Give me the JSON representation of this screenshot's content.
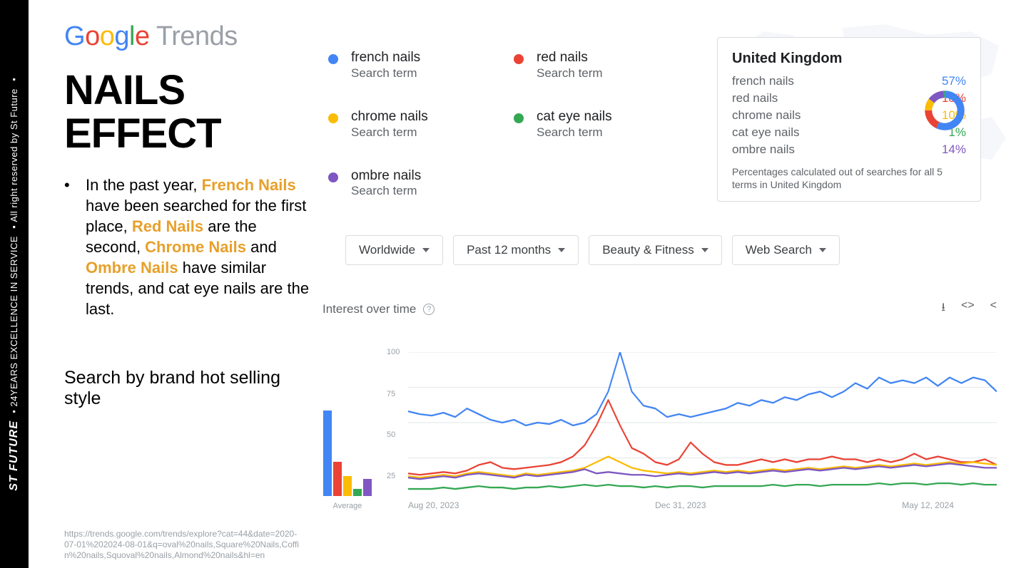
{
  "sidebar": {
    "brand": "ST FUTURE",
    "tag1": "24YEARS EXCELLENCE IN SERVICE",
    "tag2": "All right reserved by St Future"
  },
  "logo": {
    "g1": "G",
    "g2": "o",
    "g3": "o",
    "g4": "g",
    "g5": "l",
    "g6": "e",
    "trends": " Trends"
  },
  "headline": "NAILS EFFECT",
  "bullet": {
    "p1": "In the past year, ",
    "h1": "French Nails",
    "p2": " have been searched for the first place, ",
    "h2": "Red Nails",
    "p3": " are the second, ",
    "h3": "Chrome Nails",
    "p4": " and ",
    "h4": "Ombre Nails",
    "p5": " have similar trends, and cat eye nails are the last."
  },
  "subhead": "Search by brand hot selling style",
  "src_url": "https://trends.google.com/trends/explore?cat=44&date=2020-07-01%202024-08-01&q=oval%20nails,Square%20Nails,Coffin%20nails,Squoval%20nails,Almond%20nails&hl=en",
  "search_terms": [
    {
      "name": "french nails",
      "sub": "Search term",
      "color": "#4285F4"
    },
    {
      "name": "red nails",
      "sub": "Search term",
      "color": "#EA4335"
    },
    {
      "name": "chrome nails",
      "sub": "Search term",
      "color": "#FBBC05"
    },
    {
      "name": "cat eye nails",
      "sub": "Search term",
      "color": "#34A853"
    },
    {
      "name": "ombre nails",
      "sub": "Search term",
      "color": "#7E57C2"
    }
  ],
  "uk": {
    "title": "United Kingdom",
    "rows": [
      {
        "name": "french nails",
        "pct": "57%",
        "cls": "blue"
      },
      {
        "name": "red nails",
        "pct": "18%",
        "cls": "red"
      },
      {
        "name": "chrome nails",
        "pct": "10%",
        "cls": "yellow"
      },
      {
        "name": "cat eye nails",
        "pct": "1%",
        "cls": "green"
      },
      {
        "name": "ombre nails",
        "pct": "14%",
        "cls": "purple"
      }
    ],
    "note": "Percentages calculated out of searches for all 5 terms in United Kingdom"
  },
  "filters": [
    "Worldwide",
    "Past 12 months",
    "Beauty & Fitness",
    "Web Search"
  ],
  "iot": {
    "title": "Interest over time"
  },
  "chart_data": {
    "type": "line",
    "ylim": [
      0,
      100
    ],
    "yticks": [
      25,
      50,
      75,
      100
    ],
    "xticks": [
      "Aug 20, 2023",
      "Dec 31, 2023",
      "May 12, 2024"
    ],
    "average_bars": {
      "label": "Average",
      "values": {
        "french": 62,
        "red": 25,
        "chrome": 14,
        "ombre": 12,
        "cateye": 5
      }
    },
    "series": [
      {
        "name": "french nails",
        "color": "#4285F4",
        "values": [
          58,
          56,
          55,
          57,
          54,
          60,
          56,
          52,
          50,
          52,
          48,
          50,
          49,
          52,
          48,
          50,
          56,
          72,
          100,
          72,
          62,
          60,
          54,
          56,
          54,
          56,
          58,
          60,
          64,
          62,
          66,
          64,
          68,
          66,
          70,
          72,
          68,
          72,
          78,
          74,
          82,
          78,
          80,
          78,
          82,
          76,
          82,
          78,
          82,
          80,
          72
        ]
      },
      {
        "name": "red nails",
        "color": "#EA4335",
        "values": [
          14,
          13,
          14,
          15,
          14,
          16,
          20,
          22,
          18,
          17,
          18,
          19,
          20,
          22,
          26,
          34,
          48,
          66,
          48,
          32,
          28,
          22,
          20,
          24,
          36,
          28,
          22,
          20,
          20,
          22,
          24,
          22,
          24,
          22,
          24,
          24,
          26,
          24,
          24,
          22,
          24,
          22,
          24,
          28,
          24,
          26,
          24,
          22,
          22,
          24,
          20
        ]
      },
      {
        "name": "chrome nails",
        "color": "#FBBC05",
        "values": [
          12,
          11,
          12,
          13,
          12,
          14,
          15,
          14,
          13,
          12,
          14,
          13,
          14,
          15,
          16,
          18,
          22,
          26,
          22,
          18,
          16,
          15,
          14,
          15,
          14,
          15,
          16,
          15,
          16,
          15,
          16,
          17,
          16,
          17,
          18,
          17,
          18,
          19,
          18,
          19,
          20,
          19,
          20,
          21,
          20,
          21,
          22,
          21,
          22,
          21,
          20
        ]
      },
      {
        "name": "ombre nails",
        "color": "#7E57C2",
        "values": [
          11,
          10,
          11,
          12,
          11,
          13,
          14,
          13,
          12,
          11,
          13,
          12,
          13,
          14,
          15,
          17,
          14,
          15,
          14,
          13,
          13,
          12,
          13,
          14,
          13,
          14,
          15,
          14,
          15,
          14,
          15,
          16,
          15,
          16,
          17,
          16,
          17,
          18,
          17,
          18,
          19,
          18,
          19,
          20,
          19,
          20,
          21,
          20,
          19,
          18,
          18
        ]
      },
      {
        "name": "cat eye nails",
        "color": "#34A853",
        "values": [
          3,
          3,
          3,
          4,
          3,
          4,
          5,
          4,
          4,
          3,
          4,
          4,
          5,
          4,
          5,
          6,
          5,
          6,
          5,
          5,
          4,
          5,
          4,
          5,
          5,
          4,
          5,
          5,
          5,
          5,
          5,
          6,
          5,
          6,
          6,
          5,
          6,
          6,
          6,
          6,
          7,
          6,
          7,
          7,
          6,
          7,
          7,
          6,
          7,
          6,
          6
        ]
      }
    ]
  }
}
